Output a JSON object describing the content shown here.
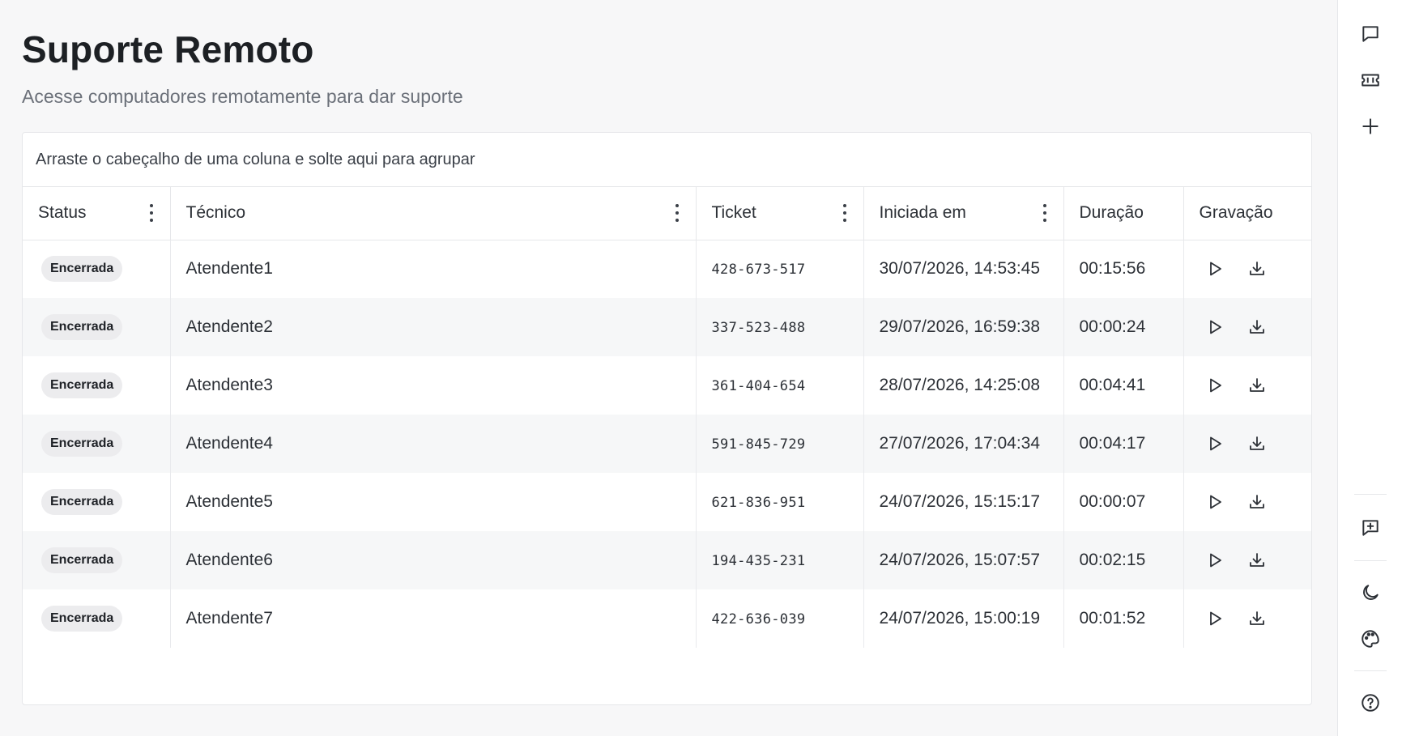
{
  "header": {
    "title": "Suporte Remoto",
    "subtitle": "Acesse computadores remotamente para dar suporte"
  },
  "grid": {
    "group_panel_text": "Arraste o cabeçalho de uma coluna e solte aqui para agrupar",
    "columns": [
      {
        "label": "Status",
        "menu": true
      },
      {
        "label": "Técnico",
        "menu": true
      },
      {
        "label": "Ticket",
        "menu": true
      },
      {
        "label": "Iniciada em",
        "menu": true
      },
      {
        "label": "Duração",
        "menu": false
      },
      {
        "label": "Gravação",
        "menu": false
      }
    ],
    "rows": [
      {
        "status": "Encerrada",
        "tecnico": "Atendente1",
        "ticket": "428-673-517",
        "iniciada": "30/07/2026, 14:53:45",
        "duracao": "00:15:56"
      },
      {
        "status": "Encerrada",
        "tecnico": "Atendente2",
        "ticket": "337-523-488",
        "iniciada": "29/07/2026, 16:59:38",
        "duracao": "00:00:24"
      },
      {
        "status": "Encerrada",
        "tecnico": "Atendente3",
        "ticket": "361-404-654",
        "iniciada": "28/07/2026, 14:25:08",
        "duracao": "00:04:41"
      },
      {
        "status": "Encerrada",
        "tecnico": "Atendente4",
        "ticket": "591-845-729",
        "iniciada": "27/07/2026, 17:04:34",
        "duracao": "00:04:17"
      },
      {
        "status": "Encerrada",
        "tecnico": "Atendente5",
        "ticket": "621-836-951",
        "iniciada": "24/07/2026, 15:15:17",
        "duracao": "00:00:07"
      },
      {
        "status": "Encerrada",
        "tecnico": "Atendente6",
        "ticket": "194-435-231",
        "iniciada": "24/07/2026, 15:07:57",
        "duracao": "00:02:15"
      },
      {
        "status": "Encerrada",
        "tecnico": "Atendente7",
        "ticket": "422-636-039",
        "iniciada": "24/07/2026, 15:00:19",
        "duracao": "00:01:52"
      }
    ],
    "row_action_icons": [
      "play-icon",
      "download-icon"
    ]
  },
  "rail": {
    "icons": [
      "chat-icon",
      "ticket-icon",
      "plus-icon",
      "message-plus-icon",
      "moon-icon",
      "palette-icon",
      "help-icon"
    ]
  },
  "colors": {
    "background": "#f7f7f8",
    "card": "#ffffff",
    "border": "#e6e7ea",
    "badge_bg": "#ececee",
    "row_alt": "#f6f7f8",
    "text": "#1f2329",
    "muted": "#6b7079"
  }
}
